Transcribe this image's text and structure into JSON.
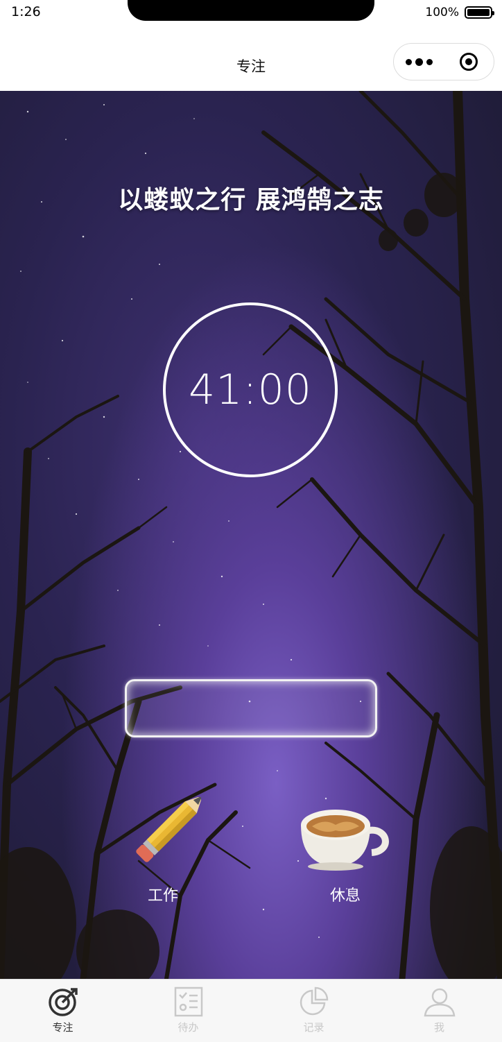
{
  "status_bar": {
    "time": "1:26",
    "battery": "100%"
  },
  "nav": {
    "title": "专注"
  },
  "main": {
    "motto": "以蝼蚁之行 展鸿鹄之志",
    "timer": "41:00",
    "task_input_value": "",
    "modes": [
      {
        "label": "工作",
        "icon": "pencil-icon"
      },
      {
        "label": "休息",
        "icon": "coffee-cup-icon"
      }
    ]
  },
  "tabbar": {
    "items": [
      {
        "label": "专注",
        "icon": "focus-target-icon",
        "active": true
      },
      {
        "label": "待办",
        "icon": "todo-list-icon",
        "active": false
      },
      {
        "label": "记录",
        "icon": "pie-chart-icon",
        "active": false
      },
      {
        "label": "我",
        "icon": "user-icon",
        "active": false
      }
    ]
  },
  "colors": {
    "active_tab": "#333333",
    "inactive_tab": "#c8c8c8",
    "sky": "#5a3f9a"
  }
}
